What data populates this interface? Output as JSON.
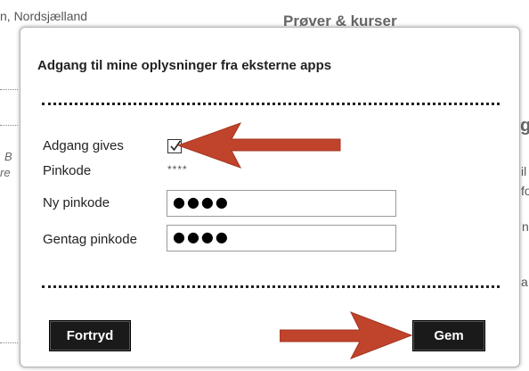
{
  "background": {
    "location_text": "n, Nordsjælland",
    "section_heading": "Prøver & kurser",
    "side_fragments": [
      "g",
      "il",
      "fo",
      "n",
      "a"
    ],
    "left_fragments": [
      "B",
      "re"
    ]
  },
  "dialog": {
    "title": "Adgang til mine oplysninger fra eksterne apps",
    "access_label": "Adgang gives",
    "access_checked": true,
    "pin_label": "Pinkode",
    "pin_value": "****",
    "new_pin_label": "Ny pinkode",
    "new_pin_value": "●●●●",
    "repeat_pin_label": "Gentag pinkode",
    "repeat_pin_value": "●●●●",
    "cancel_label": "Fortryd",
    "save_label": "Gem"
  },
  "colors": {
    "arrow": "#c0432b",
    "button_bg": "#1a1a1a"
  },
  "icons": [
    "checkmark-icon",
    "arrow-left-icon",
    "arrow-right-icon"
  ]
}
